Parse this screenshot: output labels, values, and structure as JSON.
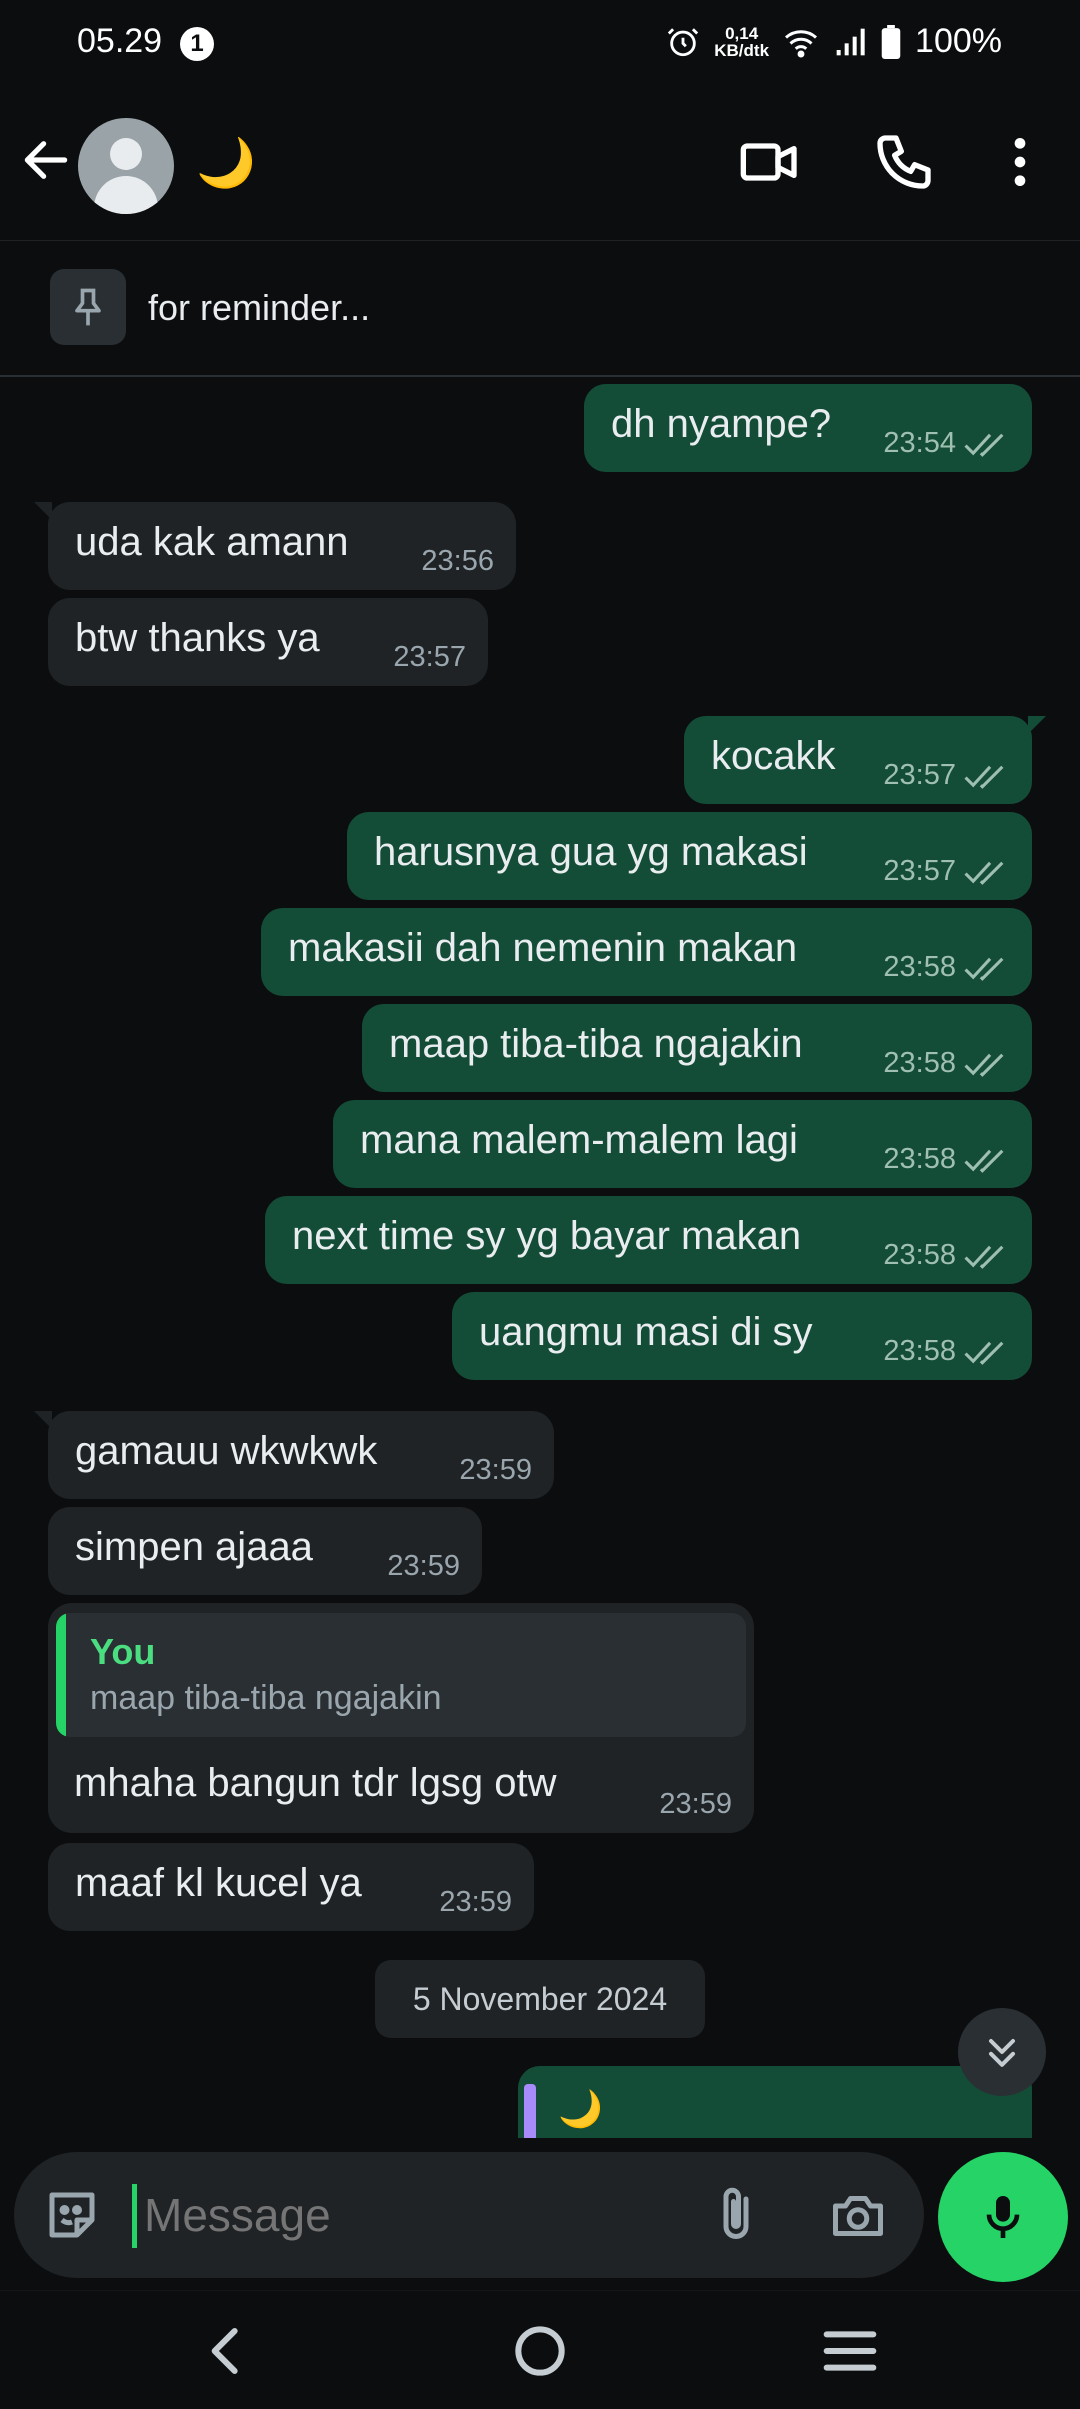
{
  "status_bar": {
    "time": "05.29",
    "notification_count": "1",
    "net_speed_top": "0,14",
    "net_speed_bottom": "KB/dtk",
    "battery": "100%"
  },
  "header": {
    "contact_name": "🌙"
  },
  "pinned": {
    "text": "for reminder..."
  },
  "messages": [
    {
      "dir": "out",
      "text": "dh nyampe?",
      "time": "23:54"
    },
    {
      "dir": "in",
      "text": "uda kak amann",
      "time": "23:56"
    },
    {
      "dir": "in",
      "text": "btw thanks ya",
      "time": "23:57"
    },
    {
      "dir": "out",
      "text": "kocakk",
      "time": "23:57"
    },
    {
      "dir": "out",
      "text": "harusnya gua yg makasi",
      "time": "23:57"
    },
    {
      "dir": "out",
      "text": "makasii dah nemenin makan",
      "time": "23:58"
    },
    {
      "dir": "out",
      "text": "maap tiba-tiba ngajakin",
      "time": "23:58"
    },
    {
      "dir": "out",
      "text": "mana malem-malem lagi",
      "time": "23:58"
    },
    {
      "dir": "out",
      "text": "next time sy yg bayar makan",
      "time": "23:58"
    },
    {
      "dir": "out",
      "text": "uangmu masi di sy",
      "time": "23:58"
    },
    {
      "dir": "in",
      "text": "gamauu wkwkwk",
      "time": "23:59"
    },
    {
      "dir": "in",
      "text": "simpen ajaaa",
      "time": "23:59"
    }
  ],
  "reply": {
    "quoted_author": "You",
    "quoted_text": "maap tiba-tiba ngajakin",
    "text": "mhaha bangun tdr lgsg otw",
    "time": "23:59"
  },
  "last_in": {
    "text": "maaf kl kucel ya",
    "time": "23:59"
  },
  "date_chip": "5 November 2024",
  "partial_message": {
    "text": "🌙"
  },
  "composer": {
    "placeholder": "Message"
  },
  "colors": {
    "background": "#0b0d0f",
    "incoming_bubble": "#1f2326",
    "outgoing_bubble": "#144d37",
    "accent": "#25d366"
  },
  "icons": {
    "back": "arrow-left-icon",
    "video": "video-camera-icon",
    "call": "phone-icon",
    "menu": "more-vertical-icon",
    "pin": "pin-icon",
    "read": "double-check-icon",
    "scroll": "chevrons-down-icon",
    "sticker": "sticker-icon",
    "attach": "paperclip-icon",
    "camera": "camera-icon",
    "mic": "microphone-icon"
  }
}
